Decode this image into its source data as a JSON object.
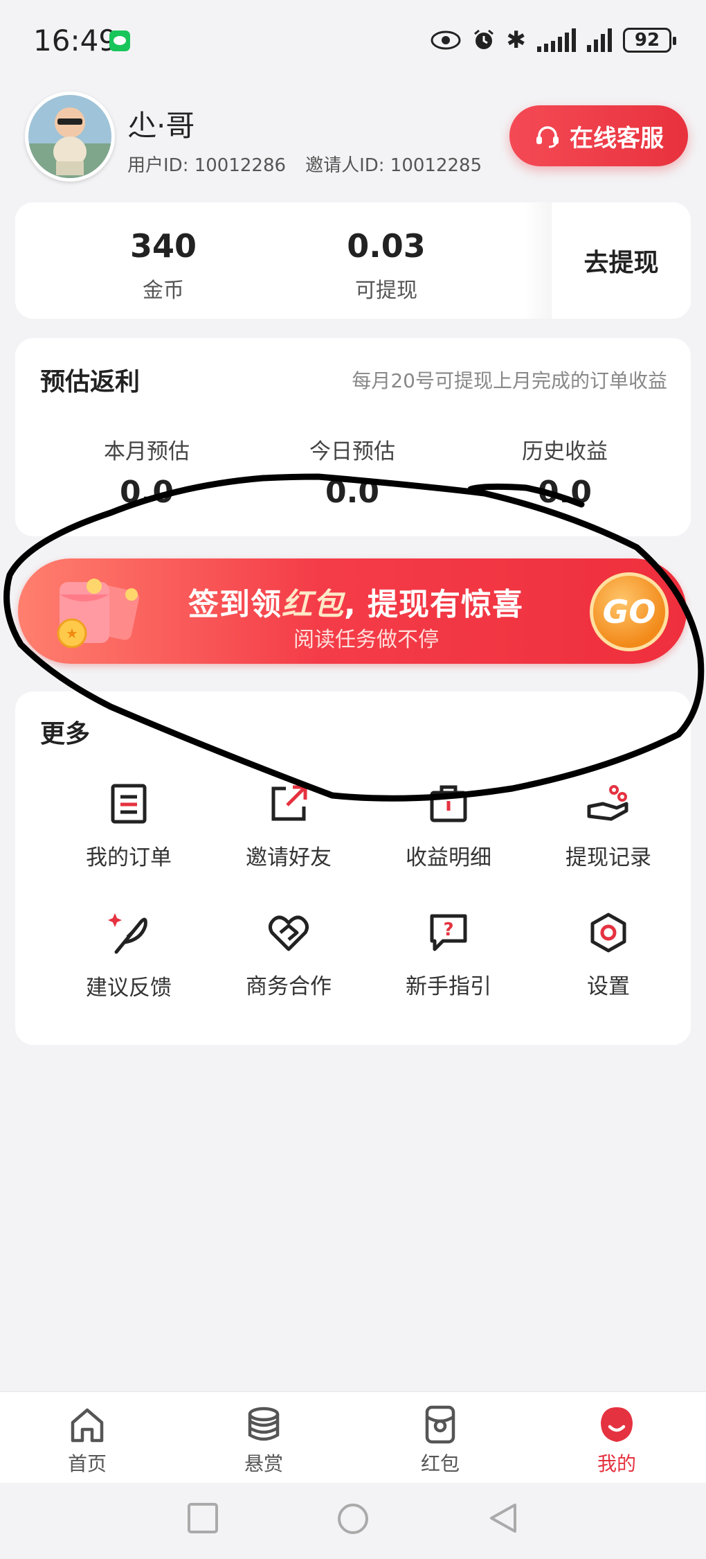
{
  "status_bar": {
    "time": "16:49",
    "battery": "92"
  },
  "profile": {
    "name": "尐·哥",
    "user_id": "用户ID: 10012286",
    "inviter_id": "邀请人ID: 10012285",
    "service_label": "在线客服"
  },
  "balance": {
    "coins_value": "340",
    "coins_label": "金币",
    "withdrawable_value": "0.03",
    "withdrawable_label": "可提现",
    "withdraw_button": "去提现"
  },
  "rebate": {
    "title": "预估返利",
    "note": "每月20号可提现上月完成的订单收益",
    "columns": [
      {
        "label": "本月预估",
        "value": "0.0"
      },
      {
        "label": "今日预估",
        "value": "0.0"
      },
      {
        "label": "历史收益",
        "value": "0.0"
      }
    ]
  },
  "banner": {
    "title_part1": "签到领",
    "title_highlight": "红包",
    "title_part2": ", 提现有惊喜",
    "subtitle": "阅读任务做不停",
    "go_label": "GO"
  },
  "more": {
    "title": "更多",
    "items": [
      {
        "label": "我的订单",
        "icon": "order-icon"
      },
      {
        "label": "邀请好友",
        "icon": "share-icon"
      },
      {
        "label": "收益明细",
        "icon": "wallet-icon"
      },
      {
        "label": "提现记录",
        "icon": "hand-coin-icon"
      },
      {
        "label": "建议反馈",
        "icon": "feather-icon"
      },
      {
        "label": "商务合作",
        "icon": "handshake-icon"
      },
      {
        "label": "新手指引",
        "icon": "help-icon"
      },
      {
        "label": "设置",
        "icon": "settings-icon"
      }
    ]
  },
  "bottom_nav": {
    "items": [
      {
        "label": "首页",
        "icon": "home-icon"
      },
      {
        "label": "悬赏",
        "icon": "coins-icon"
      },
      {
        "label": "红包",
        "icon": "red-packet-icon"
      },
      {
        "label": "我的",
        "icon": "profile-icon"
      }
    ],
    "active_color": "#e53240"
  },
  "colors": {
    "accent": "#e53240",
    "banner_red": "#f43c48",
    "go_orange": "#f28a1a"
  }
}
